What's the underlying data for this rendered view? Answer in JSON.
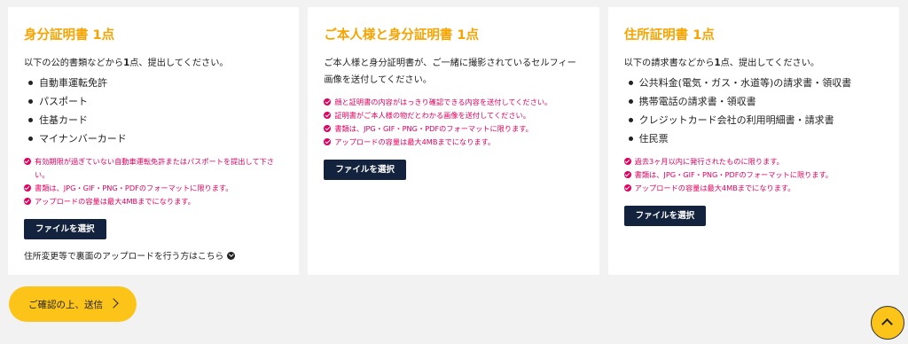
{
  "cards": [
    {
      "title": "身分証明書 1点",
      "desc_pre": "以下の公的書類などから",
      "desc_bold": "1",
      "desc_post": "点、提出してください。",
      "items": [
        "自動車運転免許",
        "パスポート",
        "住基カード",
        "マイナンバーカード"
      ],
      "notes": [
        "有効期限が過ぎていない自動車運転免許またはパスポートを提出して下さい。",
        "書類は、JPG・GIF・PNG・PDFのフォーマットに限ります。",
        "アップロードの容量は最大4MBまでになります。"
      ],
      "button": "ファイルを選択",
      "link": "住所変更等で裏面のアップロードを行う方はこちら"
    },
    {
      "title": "ご本人様と身分証明書 1点",
      "desc": "ご本人様と身分証明書が、ご一緒に撮影されているセルフィー画像を送付してください。",
      "notes": [
        "顔と証明書の内容がはっきり確認できる内容を送付してください。",
        "証明書がご本人様の物だとわかる画像を送付してください。",
        "書類は、JPG・GIF・PNG・PDFのフォーマットに限ります。",
        "アップロードの容量は最大4MBまでになります。"
      ],
      "button": "ファイルを選択"
    },
    {
      "title": "住所証明書 1点",
      "desc_pre": "以下の請求書などから",
      "desc_bold": "1",
      "desc_post": "点、提出してください。",
      "items": [
        "公共料金(電気・ガス・水道等)の請求書・領収書",
        "携帯電話の請求書・領収書",
        "クレジットカード会社の利用明細書・請求書",
        "住民票"
      ],
      "notes": [
        "過去3ヶ月以内に発行されたものに限ります。",
        "書類は、JPG・GIF・PNG・PDFのフォーマットに限ります。",
        "アップロードの容量は最大4MBまでになります。"
      ],
      "button": "ファイルを選択"
    }
  ],
  "submit_label": "ご確認の上、送信",
  "icons": {
    "note": "check-circle-icon",
    "link": "chevron-down-circle-icon",
    "submit": "chevron-right-icon",
    "scroll_top": "chevron-up-icon"
  },
  "colors": {
    "accent": "#f5a400",
    "note": "#e0005e",
    "button": "#13233d",
    "submit_bg": "#fcc419"
  }
}
